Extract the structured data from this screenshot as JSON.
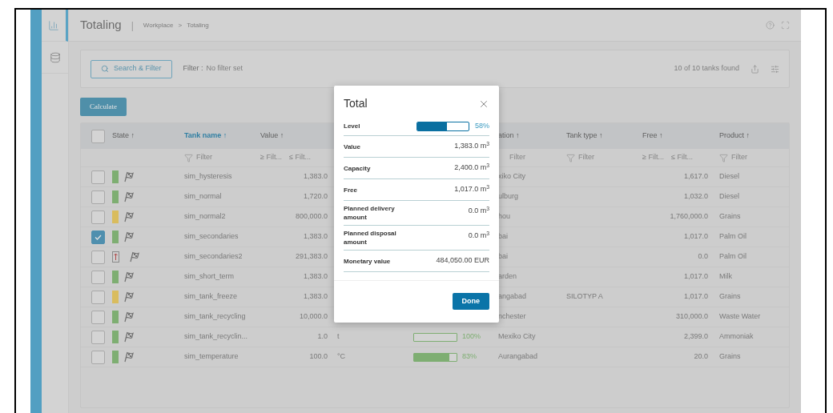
{
  "sidebar": {
    "items": [
      {
        "kind": "chart",
        "selected": true
      },
      {
        "kind": "database",
        "selected": false
      }
    ]
  },
  "header": {
    "title": "Totaling",
    "separator": "|",
    "breadcrumb": [
      "Workplace",
      "Totaling"
    ],
    "breadcrumb_separator": ">"
  },
  "filter_bar": {
    "search_button": "Search & Filter",
    "filter_label": "Filter :",
    "filter_value": "No filter set",
    "count": "10 of 10 tanks found"
  },
  "calculate_button": "Calculate",
  "table": {
    "select_all": {
      "checked": false
    },
    "columns": [
      {
        "label": "State ↑",
        "active": false
      },
      {
        "label": "Tank name ↑",
        "active": true
      },
      {
        "label": "Value ↑",
        "active": false
      },
      {},
      {},
      {
        "label": "ation ↑",
        "active": false
      },
      {
        "label": "Tank type ↑",
        "active": false
      },
      {
        "label": "Free ↑",
        "active": false
      },
      {
        "label": "Product ↑",
        "active": false
      }
    ],
    "filters": [
      {
        "kind": "none"
      },
      {
        "kind": "text",
        "placeholder": "Filter"
      },
      {
        "kind": "range",
        "min": "≥ Filt...",
        "max": "≤ Filt..."
      },
      {
        "kind": "none"
      },
      {
        "kind": "none"
      },
      {
        "kind": "plain",
        "placeholder": "Filter"
      },
      {
        "kind": "text",
        "placeholder": "Filter"
      },
      {
        "kind": "range",
        "min": "≥ Filt...",
        "max": "≤ Filt..."
      },
      {
        "kind": "text",
        "placeholder": "Filter"
      }
    ],
    "rows": [
      {
        "checked": false,
        "state": {
          "kind": "bar",
          "color": "#7eae72"
        },
        "tank_name": "sim_hysteresis",
        "value": "1,383.0",
        "location": "xiko City",
        "free": "1,617.0",
        "product": "Diesel"
      },
      {
        "checked": false,
        "state": {
          "kind": "bar",
          "color": "#7eae72"
        },
        "tank_name": "sim_normal",
        "value": "1,720.0",
        "location": "ulburg",
        "free": "1,032.0",
        "product": "Diesel"
      },
      {
        "checked": false,
        "state": {
          "kind": "bar",
          "color": "#d9bc5e"
        },
        "tank_name": "sim_normal2",
        "value": "800,000.0",
        "location": "hou",
        "free": "1,760,000.0",
        "product": "Grains"
      },
      {
        "checked": true,
        "state": {
          "kind": "bar",
          "color": "#7eae72"
        },
        "tank_name": "sim_secondaries",
        "value": "1,383.0",
        "location": "bai",
        "free": "1,017.0",
        "product": "Palm Oil"
      },
      {
        "checked": false,
        "state": {
          "kind": "alarm"
        },
        "tank_name": "sim_secondaries2",
        "value": "291,383.0",
        "location": "bai",
        "free": "0.0",
        "product": "Palm Oil"
      },
      {
        "checked": false,
        "state": {
          "kind": "bar",
          "color": "#7eae72"
        },
        "tank_name": "sim_short_term",
        "value": "1,383.0",
        "location": "arden",
        "free": "1,017.0",
        "product": "Milk"
      },
      {
        "checked": false,
        "state": {
          "kind": "bar",
          "color": "#d9bc5e"
        },
        "tank_name": "sim_tank_freeze",
        "value": "1,383.0",
        "location": "angabad",
        "tank_type": "SILOTYP A",
        "free": "1,017.0",
        "product": "Grains"
      },
      {
        "checked": false,
        "state": {
          "kind": "bar",
          "color": "#7eae72"
        },
        "tank_name": "sim_tank_recycling",
        "value": "10,000.0",
        "location": "nchester",
        "free": "310,000.0",
        "product": "Waste Water"
      },
      {
        "checked": false,
        "state": {
          "kind": "bar",
          "color": "#7eae72"
        },
        "tank_name": "sim_tank_recyclin...",
        "value": "1.0",
        "unit": "t",
        "level_text": "100%",
        "location": "Mexiko City",
        "free": "2,399.0",
        "product": "Ammoniak"
      },
      {
        "checked": false,
        "state": {
          "kind": "bar",
          "color": "#7eae72"
        },
        "tank_name": "sim_temperature",
        "value": "100.0",
        "unit": "°C",
        "level": 0.83,
        "level_text": "83%",
        "location": "Aurangabad",
        "free": "20.0",
        "product": "Grains"
      }
    ]
  },
  "dialog": {
    "title": "Total",
    "level_row": {
      "label": "Level",
      "level": 0.58,
      "reading": "58%"
    },
    "rows": [
      {
        "label": "Value",
        "value": "1,383.0 m$^{3}$"
      },
      {
        "label": "Capacity",
        "value": "2,400.0 m$^{3}$"
      },
      {
        "label": "Free",
        "value": "1,017.0 m$^{3}$"
      },
      {
        "label": "Planned delivery amount",
        "value": "0.0 m$^{3}$"
      },
      {
        "label": "Planned disposal amount",
        "value": "0.0 m$^{3}$"
      },
      {
        "label": "Monetary value",
        "value": "484,050.00 EUR"
      }
    ],
    "done_button": "Done"
  }
}
